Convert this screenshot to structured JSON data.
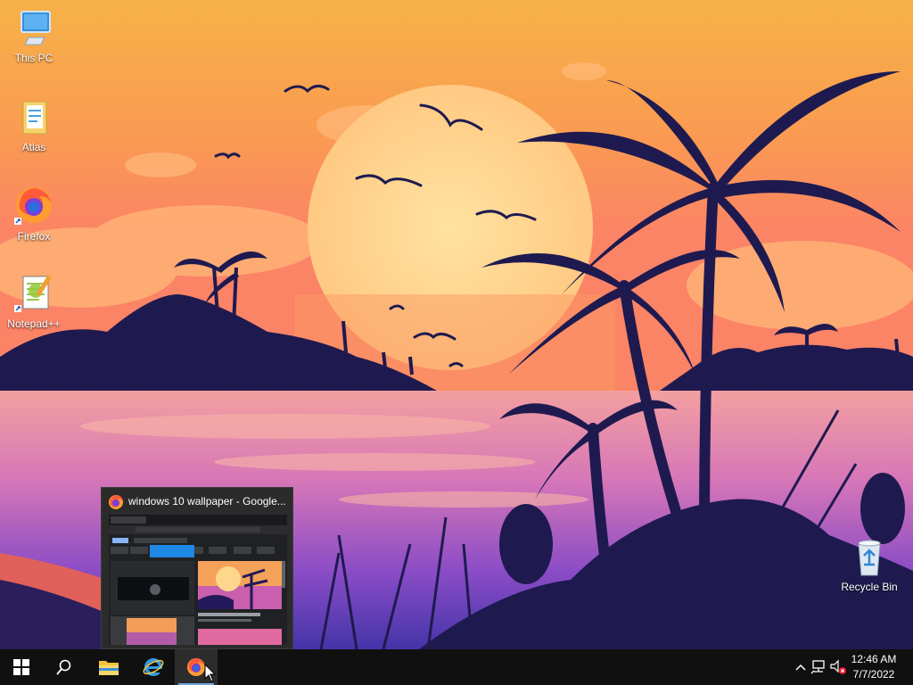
{
  "desktop": {
    "icons": [
      {
        "label": "This PC",
        "icon": "computer-icon"
      },
      {
        "label": "Atlas",
        "icon": "folder-icon"
      },
      {
        "label": "Firefox",
        "icon": "firefox-icon"
      },
      {
        "label": "Notepad++",
        "icon": "notepad-plus-plus-icon"
      },
      {
        "label": "Recycle Bin",
        "icon": "recycle-bin-icon"
      }
    ]
  },
  "taskbar_preview": {
    "title": "windows 10 wallpaper - Google...",
    "icon": "firefox-icon"
  },
  "taskbar": {
    "buttons": [
      {
        "name": "start",
        "icon": "windows-logo-icon"
      },
      {
        "name": "search",
        "icon": "search-icon"
      },
      {
        "name": "file-explorer",
        "icon": "folder-icon"
      },
      {
        "name": "internet-explorer",
        "icon": "ie-icon"
      },
      {
        "name": "firefox",
        "icon": "firefox-icon",
        "active": true
      }
    ],
    "tray": {
      "icons": [
        "chevron-up-icon",
        "network-icon",
        "volume-muted-icon"
      ],
      "time": "12:46 AM",
      "date": "7/7/2022"
    }
  },
  "colors": {
    "sky_top": "#f4a245",
    "sky_mid": "#fb8a5e",
    "sea": "#c964b8",
    "silhouette": "#1e1a4f",
    "sun": "#ffd98a",
    "taskbar": "#101010"
  }
}
